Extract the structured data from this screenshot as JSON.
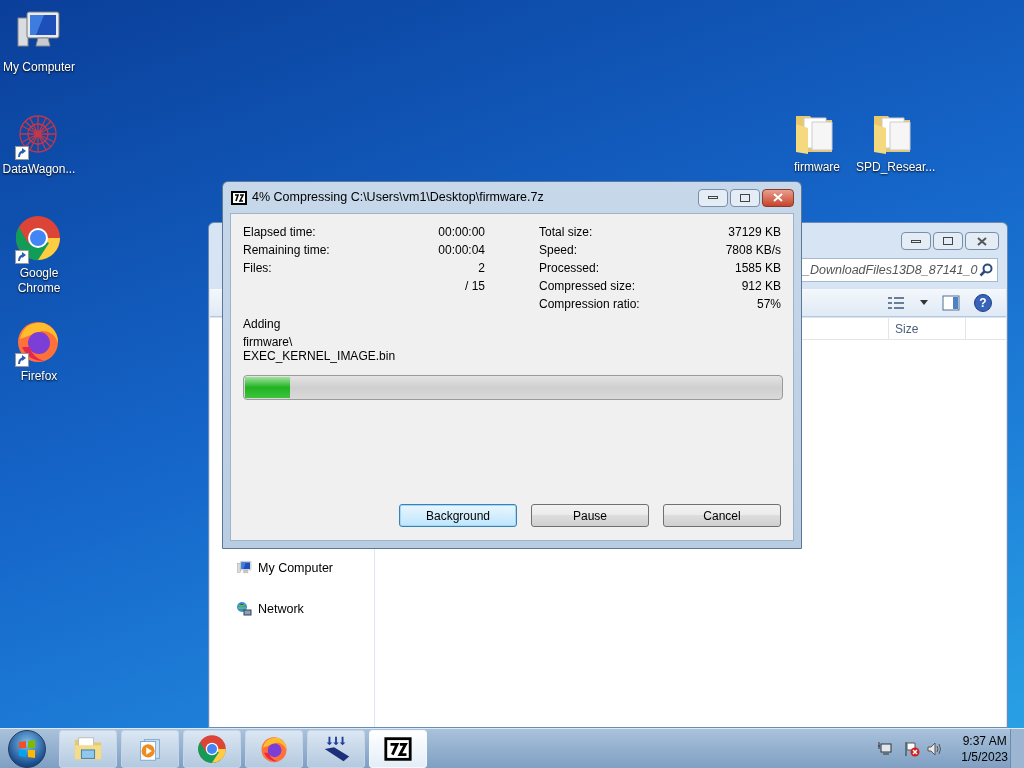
{
  "desktop_icons_left": [
    {
      "label": "My Computer",
      "kind": "computer",
      "shortcut": false
    },
    {
      "label": "DataWagon...",
      "kind": "datawagon",
      "shortcut": true
    },
    {
      "label": "Google Chrome",
      "kind": "chrome",
      "shortcut": true
    },
    {
      "label": "Firefox",
      "kind": "firefox",
      "shortcut": true
    }
  ],
  "desktop_icons_right": [
    {
      "label": "firmware",
      "kind": "folder",
      "shortcut": false
    },
    {
      "label": "SPD_Resear...",
      "kind": "folder",
      "shortcut": false
    }
  ],
  "explorer": {
    "help_glyph": "?",
    "search_value": "_DownloadFiles13D8_87141_0",
    "columns": [
      "Size"
    ],
    "nav_items": [
      {
        "label": "My Computer",
        "kind": "computer"
      },
      {
        "label": "Network",
        "kind": "network"
      }
    ]
  },
  "dialog": {
    "title": "4% Compressing C:\\Users\\vm1\\Desktop\\firmware.7z",
    "left_stats": [
      {
        "label": "Elapsed time:",
        "value": "00:00:00"
      },
      {
        "label": "Remaining time:",
        "value": "00:00:04"
      },
      {
        "label": "Files:",
        "value": "2"
      },
      {
        "value": "/ 15"
      }
    ],
    "right_stats": [
      {
        "label": "Total size:",
        "value": "37129 KB"
      },
      {
        "label": "Speed:",
        "value": "7808 KB/s"
      },
      {
        "label": "Processed:",
        "value": "1585 KB"
      },
      {
        "label": "Compressed size:",
        "value": "912 KB"
      },
      {
        "label": "Compression ratio:",
        "value": "57%"
      }
    ],
    "action": "Adding",
    "current_folder": "firmware\\",
    "current_file": "EXEC_KERNEL_IMAGE.bin",
    "progress": {
      "level": 0.084
    },
    "buttons": [
      {
        "label": "Background",
        "selected": true
      },
      {
        "label": "Pause",
        "selected": false
      },
      {
        "label": "Cancel",
        "selected": false
      }
    ]
  },
  "taskbar": {
    "items": [
      {
        "kind": "explorer",
        "selected": false
      },
      {
        "kind": "media",
        "selected": false
      },
      {
        "kind": "chrome",
        "selected": false
      },
      {
        "kind": "firefox",
        "selected": false
      },
      {
        "kind": "download",
        "selected": false
      },
      {
        "kind": "sevenzip",
        "selected": true
      }
    ],
    "time": "9:37 AM",
    "date": "1/5/2023"
  }
}
